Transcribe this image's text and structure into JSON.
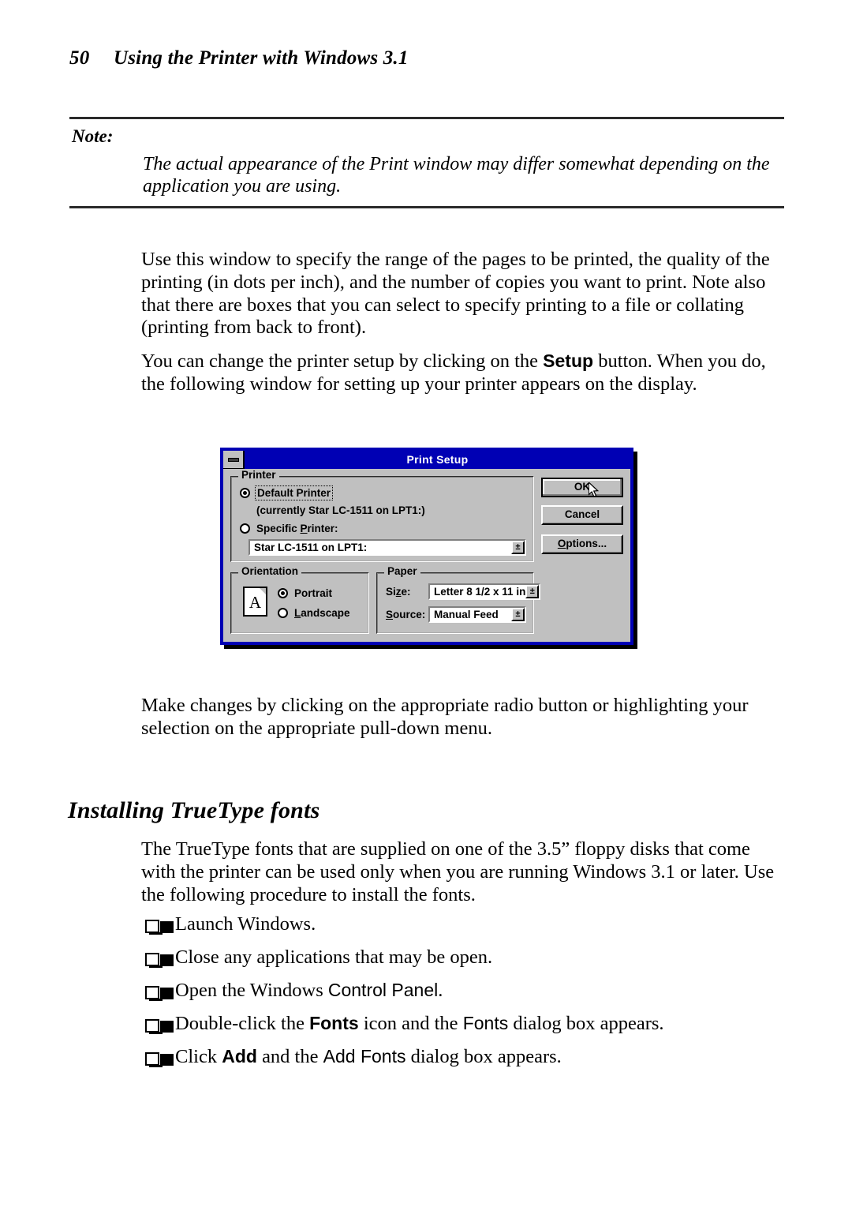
{
  "page": {
    "folio": "50",
    "running_head": "Using the Printer with Windows 3.1"
  },
  "note": {
    "label": "Note:",
    "body": "The actual appearance of the Print window may differ somewhat depending on the application you are using."
  },
  "paragraphs": {
    "p1": "Use this window to specify the range of the pages to be printed, the quality of the printing (in dots per inch), and the number of copies you want to print. Note also that there are boxes that you can select to specify printing to a file or collating (printing from back to front).",
    "p2_part1": "You can change the printer setup by clicking on the ",
    "p2_bold": "Setup",
    "p2_part2": " button. When you do, the following window for setting up your printer appears on the display.",
    "p3": "Make changes by clicking on the appropriate radio button or highlighting your selection on the appropriate pull-down menu.",
    "p4": "The TrueType fonts that are supplied on one of the 3.5” floppy disks that come with the printer can be used only when you are running Windows 3.1 or later. Use the following procedure to install the fonts."
  },
  "section": {
    "heading": "Installing TrueType fonts"
  },
  "checklist": [
    {
      "text": "Launch Windows."
    },
    {
      "text": "Close any applications that may be open."
    },
    {
      "pre": "Open the Windows ",
      "sans": "Control Panel",
      "post": "."
    },
    {
      "pre": "Double-click the ",
      "bold": "Fonts",
      "mid": " icon and the ",
      "sans": "Fonts",
      "post": " dialog box appears."
    },
    {
      "pre": "Click ",
      "bold": "Add",
      "mid": " and the ",
      "sans": "Add Fonts",
      "post": " dialog box appears."
    }
  ],
  "dialog": {
    "title": "Print Setup",
    "minimize_icon": "minimize-box",
    "printer_group": {
      "label": "Printer",
      "default_radio_label": "Default Printer",
      "default_radio_selected": true,
      "currently_line": "(currently Star LC-1511 on LPT1:)",
      "specific_radio_label_pre": "Specific ",
      "specific_radio_label_mnemonic": "P",
      "specific_radio_label_post": "rinter:",
      "specific_radio_selected": false,
      "printer_combo_value": "Star LC-1511 on LPT1:",
      "combo_arrow": "±"
    },
    "orientation_group": {
      "label": "Orientation",
      "icon_letter": "A",
      "portrait_label": "Portrait",
      "portrait_selected": true,
      "landscape_label_mnemonic": "L",
      "landscape_label_post": "andscape",
      "landscape_selected": false
    },
    "paper_group": {
      "label": "Paper",
      "size_label_pre": "Si",
      "size_label_mnemonic": "z",
      "size_label_post": "e:",
      "size_value": "Letter 8 1/2 x 11 in",
      "source_label_mnemonic": "S",
      "source_label_post": "ource:",
      "source_value": "Manual Feed",
      "combo_arrow": "±"
    },
    "buttons": {
      "ok": "OK",
      "cancel": "Cancel",
      "options": "Options..."
    },
    "colors": {
      "titlebar": "#0000b4",
      "face": "#c0c0c0",
      "title_text": "#ffffff"
    }
  }
}
